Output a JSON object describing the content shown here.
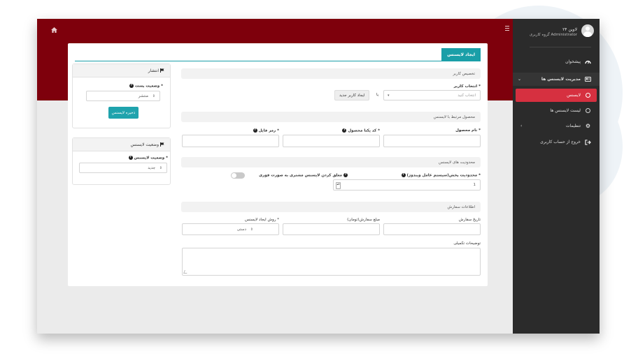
{
  "user": {
    "name": "لاوین ۲۴",
    "group": "گروه کاربری Administrator"
  },
  "sidebar": {
    "items": [
      {
        "label": "پیشخوان",
        "icon": "dashboard-icon"
      },
      {
        "label": "مدیریت لایسنس ها",
        "icon": "id-card-icon"
      },
      {
        "label": "لایسنس",
        "icon": "circle-icon"
      },
      {
        "label": "لیست لایسنس ها",
        "icon": "circle-icon"
      },
      {
        "label": "تنظیمات",
        "icon": "gear-icon"
      },
      {
        "label": "خروج از حساب کاربری",
        "icon": "sign-out-icon"
      }
    ]
  },
  "card": {
    "title": "ایجاد لایسنس"
  },
  "sections": {
    "user": "تخصیص کاربر",
    "product": "محصول مرتبط با لایسنس",
    "limits": "محدودیت های لایسنس",
    "order": "اطلاعات سفارش"
  },
  "form": {
    "select_user_label": "انتخاب کاربر *",
    "select_user_placeholder": "انتخاب کنید",
    "or_label": "یا",
    "new_user_button": "ایجاد کاربر جدید",
    "product_name_label": "نام محصول *",
    "product_code_label": "کد یکتا محصول *",
    "file_code_label": "رمز فایل *",
    "distribution_limit_label": "محدودیت پخش(سیستم عامل ویندوز) *",
    "distribution_limit_value": "1",
    "suspend_label": "معلق کردن لایسنس مشتری به صورت فوری",
    "order_date_label": "تاریخ سفارش",
    "order_amount_label": "مبلغ سفارش(تومان)",
    "create_method_label": "روش ایجاد لایسنس *",
    "create_method_value": "دستی",
    "notes_label": "توضیحات تکمیلی"
  },
  "publish_panel": {
    "title": "انتشار",
    "status_label": "وضعیت پست *",
    "status_value": "منتشر",
    "save_button": "ذخیره لایسنس"
  },
  "license_panel": {
    "title": "وضعیت لایسنس",
    "status_label": "وضعیت لایسنس *",
    "status_value": "جدید"
  },
  "colors": {
    "top_band": "#7e000c",
    "sidebar": "#2b2b2b",
    "active": "#d63040",
    "accent": "#1a9fa8"
  }
}
